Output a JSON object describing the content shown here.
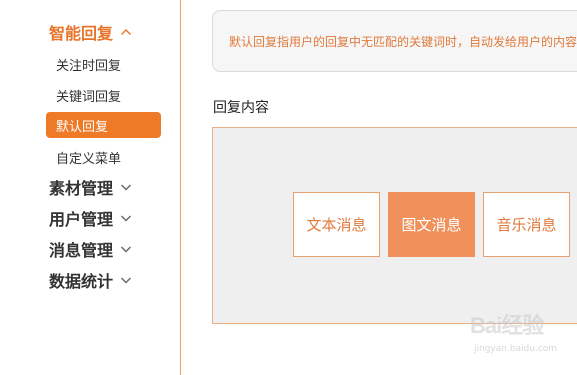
{
  "sidebar": {
    "groups": [
      {
        "label": "智能回复",
        "expanded": true
      },
      {
        "label": "素材管理",
        "expanded": false
      },
      {
        "label": "用户管理",
        "expanded": false
      },
      {
        "label": "消息管理",
        "expanded": false
      },
      {
        "label": "数据统计",
        "expanded": false
      }
    ],
    "smart_reply_items": [
      {
        "label": "关注时回复",
        "selected": false
      },
      {
        "label": "关键词回复",
        "selected": false
      },
      {
        "label": "默认回复",
        "selected": true
      },
      {
        "label": "自定义菜单",
        "selected": false
      }
    ]
  },
  "notice": {
    "text": "默认回复指用户的回复中无匹配的关键词时，自动发给用户的内容"
  },
  "reply_content": {
    "title": "回复内容",
    "types": [
      {
        "label": "文本消息",
        "active": false
      },
      {
        "label": "图文消息",
        "active": true
      },
      {
        "label": "音乐消息",
        "active": false
      }
    ]
  },
  "watermark": {
    "brand": "Bai经验",
    "url": "jingyan.baidu.com"
  },
  "colors": {
    "accent": "#ee7a28",
    "accent_light": "#f0905a",
    "border": "#e8a070",
    "panel_bg": "#efefef"
  }
}
